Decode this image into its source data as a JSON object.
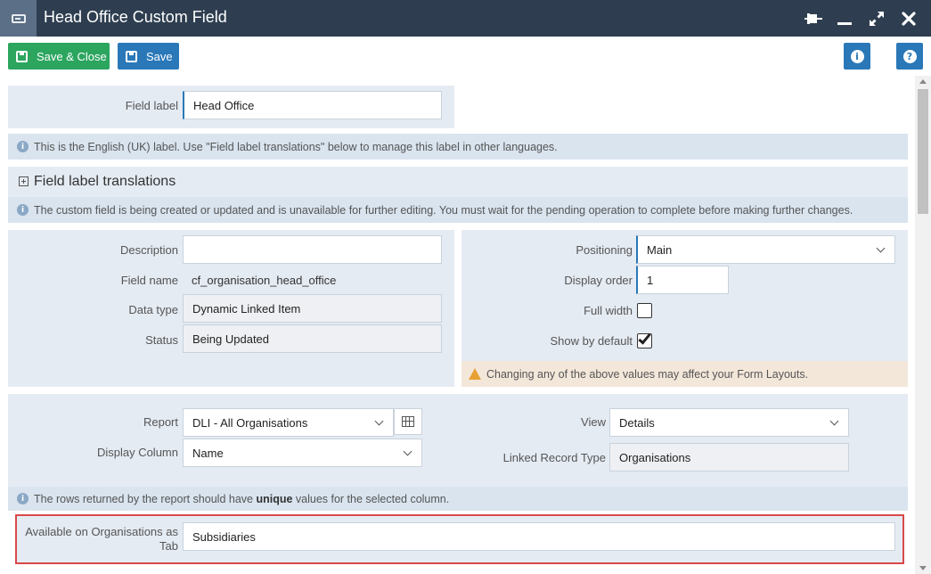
{
  "window": {
    "title": "Head Office Custom Field",
    "icons": [
      "pin-icon",
      "minimize-icon",
      "maximize-icon",
      "close-icon"
    ]
  },
  "toolbar": {
    "save_close_label": "Save & Close",
    "save_label": "Save",
    "info_glyph": "i",
    "help_glyph": "?"
  },
  "field_label": {
    "label": "Field label",
    "value": "Head Office",
    "note": "This is the English (UK) label. Use \"Field label translations\" below to manage this label in other languages."
  },
  "translations": {
    "heading": "Field label translations",
    "note": "The custom field is being created or updated and is unavailable for further editing. You must wait for the pending operation to complete before making further changes."
  },
  "details": {
    "description_label": "Description",
    "description_value": "",
    "field_name_label": "Field name",
    "field_name_value": "cf_organisation_head_office",
    "data_type_label": "Data type",
    "data_type_value": "Dynamic Linked Item",
    "status_label": "Status",
    "status_value": "Being Updated"
  },
  "layout": {
    "positioning_label": "Positioning",
    "positioning_value": "Main",
    "display_order_label": "Display order",
    "display_order_value": "1",
    "full_width_label": "Full width",
    "full_width_checked": false,
    "show_default_label": "Show by default",
    "show_default_checked": true,
    "warning": "Changing any of the above values may affect your Form Layouts."
  },
  "report": {
    "report_label": "Report",
    "report_value": "DLI - All Organisations",
    "display_column_label": "Display Column",
    "display_column_value": "Name",
    "view_label": "View",
    "view_value": "Details",
    "linked_type_label": "Linked Record Type",
    "linked_type_value": "Organisations",
    "note_before": "The rows returned by the report should have ",
    "note_bold": "unique",
    "note_after": " values for the selected column.",
    "available_label_line1": "Available on Organisations as",
    "available_label_line2": "Tab",
    "available_value": "Subsidiaries"
  },
  "colors": {
    "titlebar": "#2e3e50",
    "save_close": "#2ca55f",
    "save": "#2a78b8",
    "panel": "#e5ebf3",
    "highlight_border": "#d9484a"
  }
}
